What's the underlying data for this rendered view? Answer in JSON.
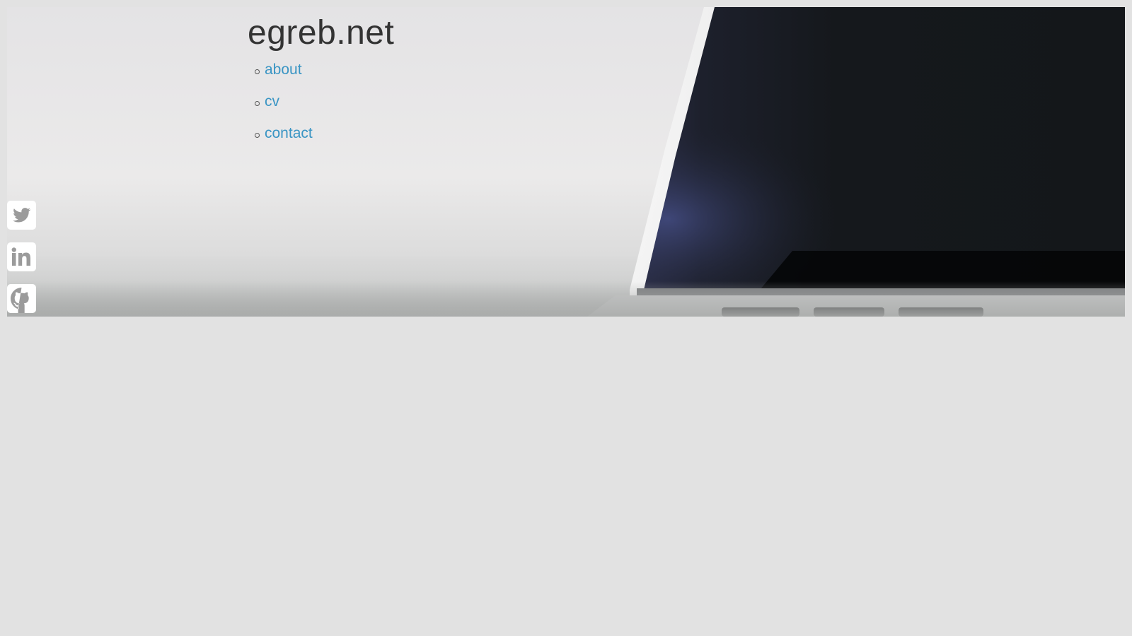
{
  "site": {
    "title": "egreb.net"
  },
  "nav": {
    "items": [
      {
        "label": "about"
      },
      {
        "label": "cv"
      },
      {
        "label": "contact"
      }
    ]
  },
  "social": {
    "items": [
      {
        "icon": "twitter-icon"
      },
      {
        "icon": "linkedin-icon"
      },
      {
        "icon": "github-icon"
      }
    ]
  },
  "colors": {
    "background": "#e2e2e2",
    "title": "#333333",
    "link": "#3a95c4",
    "icon_fill": "#9b9b9b",
    "icon_bg": "#ffffff"
  }
}
